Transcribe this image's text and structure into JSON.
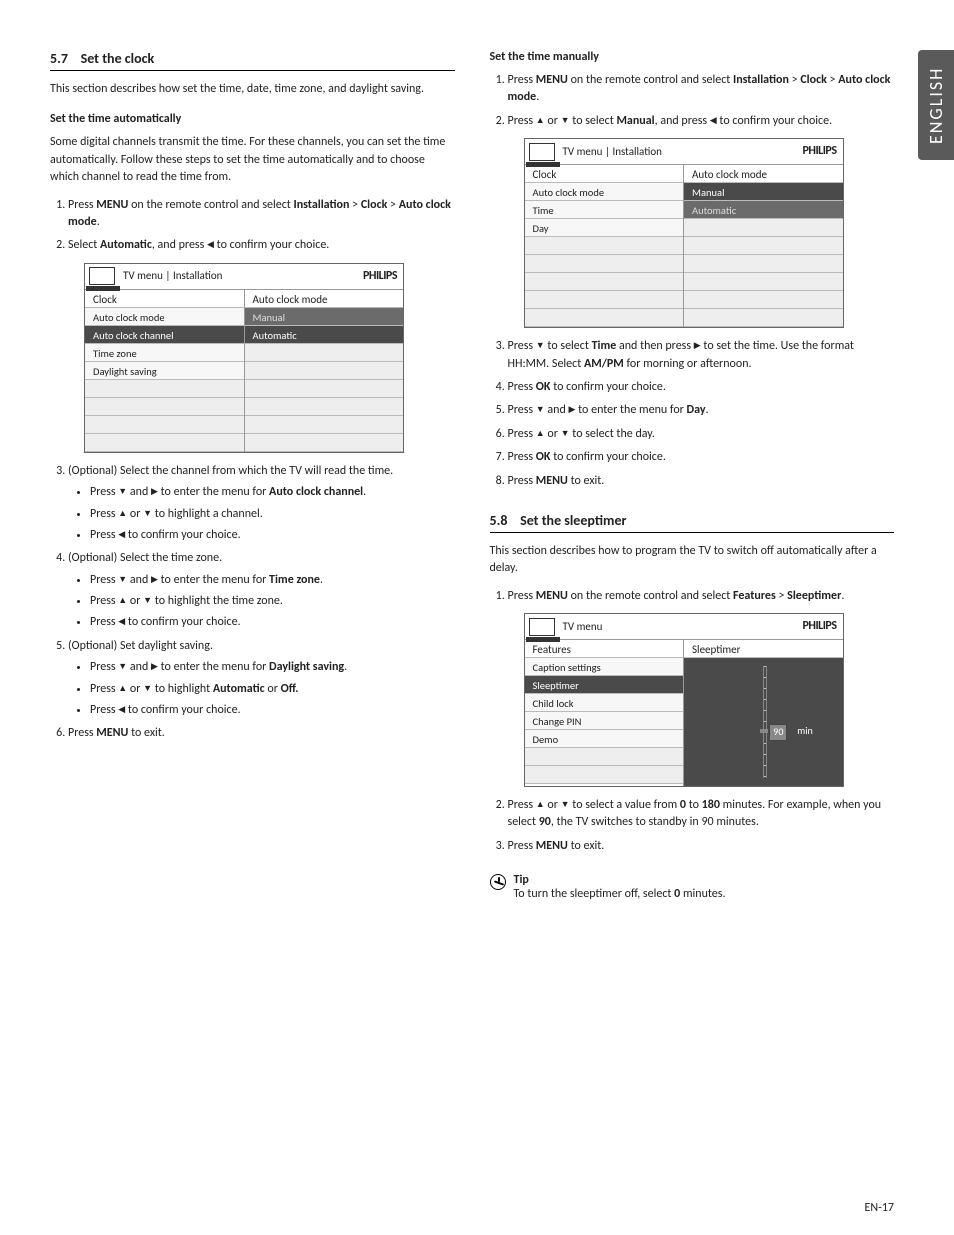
{
  "sideTab": "ENGLISH",
  "footer": "EN-17",
  "sec57": {
    "num": "5.7",
    "title": "Set the clock",
    "intro": "This section describes how set the time, date, time zone, and daylight saving.",
    "autoHead": "Set the time automatically",
    "autoIntro": "Some digital channels transmit the time.  For these channels, you can set the time automatically.  Follow these steps to set the time automatically and to choose which channel to read the time from.",
    "step1a": "Press ",
    "step1b": "MENU",
    "step1c": " on the remote control and select ",
    "step1d": "Installation",
    "step1e": " > ",
    "step1f": "Clock",
    "step1g": " > ",
    "step1h": "Auto clock mode",
    "step1i": ".",
    "step2a": "Select ",
    "step2b": "Automatic",
    "step2c": ", and press ",
    "step2d": " to confirm your choice.",
    "step3a": "(Optional) Select the channel from which the TV will read the time.",
    "s3b1a": "Press ",
    "s3b1b": " and ",
    "s3b1c": " to enter the menu for ",
    "s3b1d": "Auto clock channel",
    "s3b1e": ".",
    "s3b2a": "Press ",
    "s3b2b": " or ",
    "s3b2c": " to highlight a channel.",
    "s3b3a": "Press ",
    "s3b3b": " to confirm your choice.",
    "step4a": "(Optional) Select the time zone.",
    "s4b1a": "Press ",
    "s4b1b": " and ",
    "s4b1c": " to enter the menu for ",
    "s4b1d": "Time zone",
    "s4b1e": ".",
    "s4b2a": "Press ",
    "s4b2b": " or ",
    "s4b2c": " to highlight the time zone.",
    "s4b3a": "Press ",
    "s4b3b": " to confirm your choice.",
    "step5a": "(Optional) Set daylight saving.",
    "s5b1a": "Press ",
    "s5b1b": " and ",
    "s5b1c": " to enter the menu for ",
    "s5b1d": "Daylight saving",
    "s5b1e": ".",
    "s5b2a": "Press ",
    "s5b2b": " or ",
    "s5b2c": " to highlight ",
    "s5b2d": "Automatic",
    "s5b2e": " or ",
    "s5b2f": "Off.",
    "s5b3a": "Press ",
    "s5b3b": " to confirm your choice.",
    "step6a": "Press ",
    "step6b": "MENU",
    "step6c": " to exit.",
    "tv1": {
      "crumb": "TV menu | Installation",
      "logo": "PHILIPS",
      "leftLabel": "Clock",
      "rightLabel": "Auto clock mode",
      "left": [
        "Auto clock mode",
        "Auto clock channel",
        "Time zone",
        "Daylight saving"
      ],
      "right": [
        "Manual",
        "Automatic"
      ]
    }
  },
  "manual": {
    "head": "Set the time manually",
    "step1a": "Press ",
    "step1b": "MENU",
    "step1c": " on the remote control and select ",
    "step1d": "Installation",
    "step1e": " > ",
    "step1f": "Clock",
    "step1g": " > ",
    "step1h": "Auto clock mode",
    "step1i": ".",
    "step2a": "Press ",
    "step2b": " or ",
    "step2c": " to select ",
    "step2d": "Manual",
    "step2e": ", and press ",
    "step2f": " to confirm your choice.",
    "step3a": "Press ",
    "step3b": " to select ",
    "step3c": "Time",
    "step3d": " and then press ",
    "step3e": " to set the time. Use the format HH:MM.  Select ",
    "step3f": "AM/PM",
    "step3g": " for morning or afternoon.",
    "step4a": "Press ",
    "step4b": "OK",
    "step4c": " to confirm your choice.",
    "step5a": "Press ",
    "step5b": " and ",
    "step5c": " to enter the menu for ",
    "step5d": "Day",
    "step5e": ".",
    "step6a": "Press ",
    "step6b": " or ",
    "step6c": " to select the day.",
    "step7a": "Press ",
    "step7b": "OK",
    "step7c": " to confirm your choice.",
    "step8a": "Press ",
    "step8b": "MENU",
    "step8c": " to exit.",
    "tv2": {
      "crumb": "TV menu | Installation",
      "logo": "PHILIPS",
      "leftLabel": "Clock",
      "rightLabel": "Auto clock mode",
      "left": [
        "Auto clock mode",
        "Time",
        "Day"
      ],
      "right": [
        "Manual",
        "Automatic"
      ]
    }
  },
  "sec58": {
    "num": "5.8",
    "title": "Set the sleeptimer",
    "intro": "This section describes how to program the TV to switch off automatically after a delay.",
    "step1a": "Press ",
    "step1b": "MENU",
    "step1c": " on the remote control and select ",
    "step1d": "Features",
    "step1e": " > ",
    "step1f": "Sleeptimer",
    "step1g": ".",
    "step2a": "Press ",
    "step2b": " or ",
    "step2c": " to select a value from ",
    "step2d": "0",
    "step2e": " to ",
    "step2f": "180",
    "step2g": " minutes. For example, when you select ",
    "step2h": "90",
    "step2i": ", the TV switches to standby in 90 minutes.",
    "step3a": "Press ",
    "step3b": "MENU",
    "step3c": " to exit.",
    "tipLabel": "Tip",
    "tipText1": "To turn the sleeptimer off, select ",
    "tipText2": "0",
    "tipText3": " minutes.",
    "tv3": {
      "crumb": "TV menu",
      "logo": "PHILIPS",
      "leftLabel": "Features",
      "rightLabel": "Sleeptimer",
      "left": [
        "Caption settings",
        "Sleeptimer",
        "Child lock",
        "Change PIN",
        "Demo"
      ],
      "sliderValue": "90",
      "sliderUnit": "min"
    }
  }
}
